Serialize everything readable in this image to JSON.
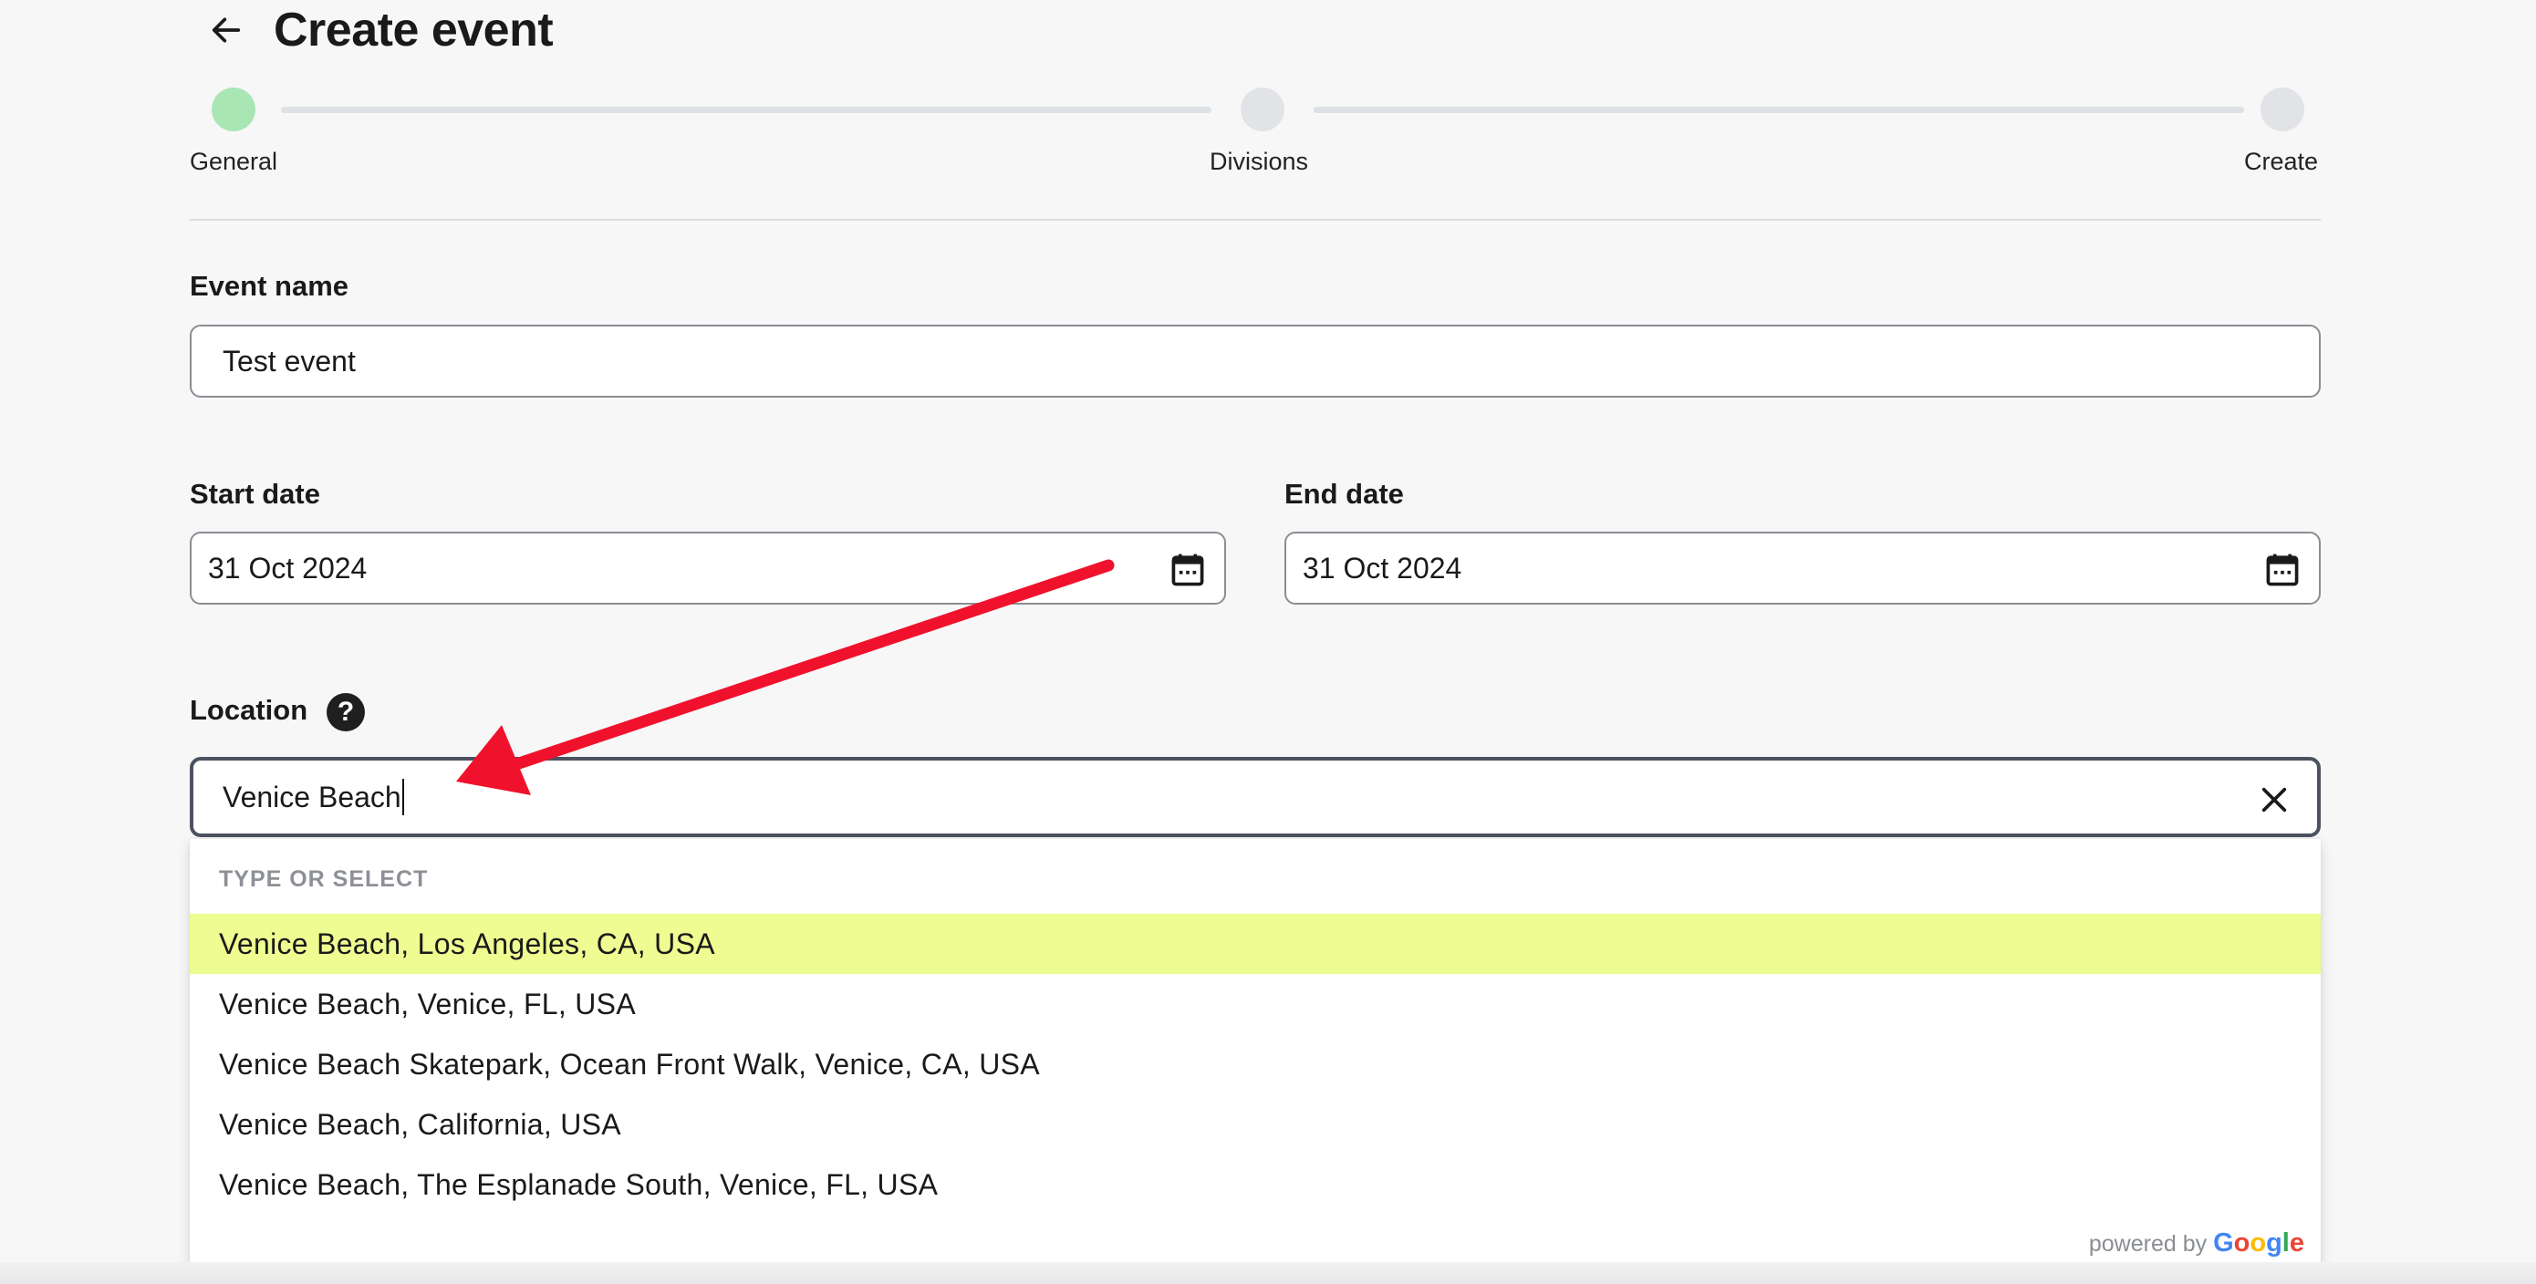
{
  "header": {
    "title": "Create event",
    "back_icon": "arrow-left-icon"
  },
  "stepper": {
    "steps": [
      {
        "label": "General",
        "state": "active"
      },
      {
        "label": "Divisions",
        "state": "inactive"
      },
      {
        "label": "Create",
        "state": "inactive"
      }
    ],
    "colors": {
      "active": "#a8e6b4",
      "inactive": "#e1e3e6"
    }
  },
  "form": {
    "event_name": {
      "label": "Event name",
      "value": "Test event"
    },
    "start_date": {
      "label": "Start date",
      "value": "31 Oct 2024",
      "icon": "calendar-icon"
    },
    "end_date": {
      "label": "End date",
      "value": "31 Oct 2024",
      "icon": "calendar-icon"
    },
    "location": {
      "label": "Location",
      "help_glyph": "?",
      "help_icon": "question-circle-icon",
      "value": "Venice Beach",
      "clear_icon": "close-icon"
    }
  },
  "dropdown": {
    "header": "TYPE OR SELECT",
    "items": [
      "Venice Beach, Los Angeles, CA, USA",
      "Venice Beach, Venice, FL, USA",
      "Venice Beach Skatepark, Ocean Front Walk, Venice, CA, USA",
      "Venice Beach, California, USA",
      "Venice Beach, The Esplanade South, Venice, FL, USA"
    ],
    "highlighted_index": 0,
    "highlight_color": "#eefd91",
    "powered_by": "powered by",
    "powered_brand": [
      "G",
      "o",
      "o",
      "g",
      "l",
      "e"
    ]
  },
  "annotation": {
    "arrow_color": "#f0122d"
  }
}
